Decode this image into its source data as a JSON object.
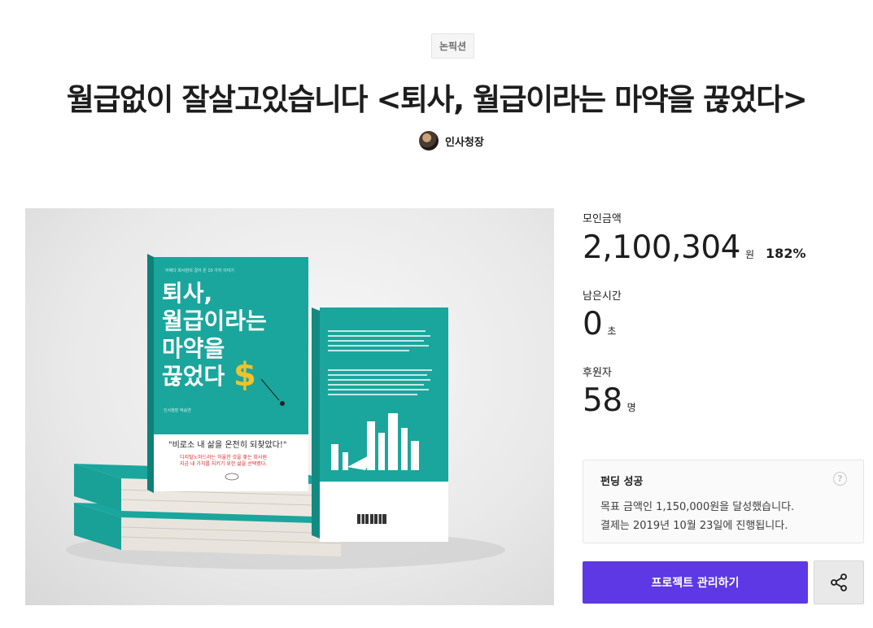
{
  "project": {
    "category": "논픽션",
    "title": "월급없이 잘살고있습니다 <퇴사, 월급이라는 마약을 끊었다>",
    "creator": "인사청장"
  },
  "book_cover": {
    "subtitle": "어쩌다 회사원의 걸어 온 10 가지 이야기",
    "title_lines": [
      "퇴사,",
      "월급이라는",
      "마약을",
      "끊었다"
    ],
    "author": "인사청장 박승연",
    "quote": "\"비로소 내 삶을 온전히 되찾았다!\"",
    "tagline_1": "디지털노마드라는 허울한 것을 좇는 회사원",
    "tagline_2": "지금 내 가치를 지키기 위한 삶을 선택했다."
  },
  "stats": {
    "funded_label": "모인금액",
    "funded_amount": "2,100,304",
    "funded_unit": "원",
    "funded_rate": "182%",
    "time_left_label": "남은시간",
    "time_left_value": "0",
    "time_left_unit": "초",
    "backers_label": "후원자",
    "backers_value": "58",
    "backers_unit": "명"
  },
  "status_box": {
    "title": "펀딩 성공",
    "line_1": "목표 금액인 1,150,000원을 달성했습니다.",
    "line_2": "결제는 2019년 10월 23일에 진행됩니다.",
    "help_glyph": "?"
  },
  "actions": {
    "manage_label": "프로젝트 관리하기",
    "share_icon": "share-icon"
  },
  "colors": {
    "accent": "#5d38e4",
    "book_teal": "#1aa69c",
    "dollar": "#f2c22b"
  }
}
